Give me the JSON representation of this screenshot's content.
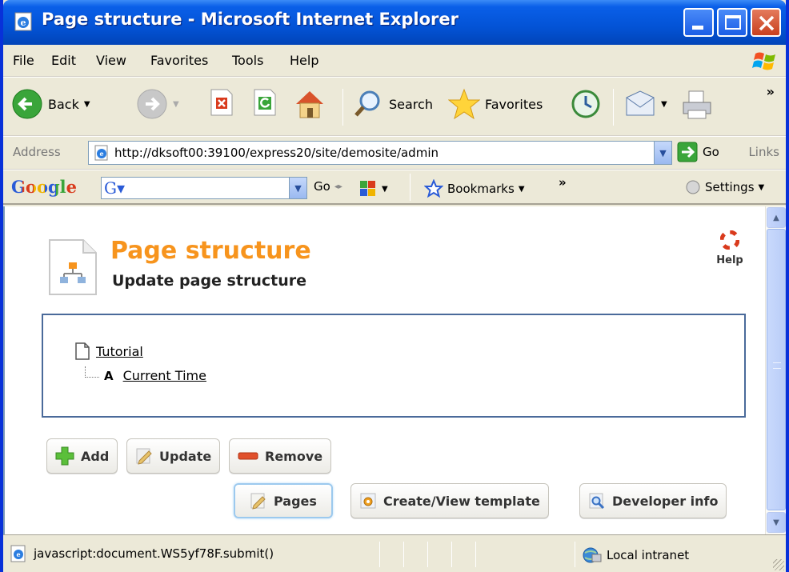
{
  "window": {
    "title": "Page structure - Microsoft Internet Explorer"
  },
  "menu": {
    "items": [
      "File",
      "Edit",
      "View",
      "Favorites",
      "Tools",
      "Help"
    ]
  },
  "toolbar": {
    "back_label": "Back",
    "search_label": "Search",
    "favorites_label": "Favorites",
    "more": "»"
  },
  "address": {
    "label": "Address",
    "url": "http://dksoft00:39100/express20/site/demosite/admin",
    "go_label": "Go",
    "links_label": "Links"
  },
  "google_toolbar": {
    "logo": "Google",
    "go_label": "Go",
    "bookmarks_label": "Bookmarks",
    "more": "»",
    "settings_label": "Settings"
  },
  "page": {
    "title": "Page structure",
    "subtitle": "Update page structure",
    "help_label": "Help",
    "tree": {
      "root": "Tutorial",
      "child_type": "A",
      "child": "Current Time"
    },
    "actions": {
      "add": "Add",
      "update": "Update",
      "remove": "Remove"
    },
    "nav": {
      "pages": "Pages",
      "template": "Create/View template",
      "developer": "Developer info"
    }
  },
  "status": {
    "text": "javascript:document.WS5yf78F.submit()",
    "zone": "Local intranet"
  },
  "colors": {
    "title_accent": "#f7941d",
    "xp_blue": "#0353d6",
    "frame": "#ece9d8"
  }
}
